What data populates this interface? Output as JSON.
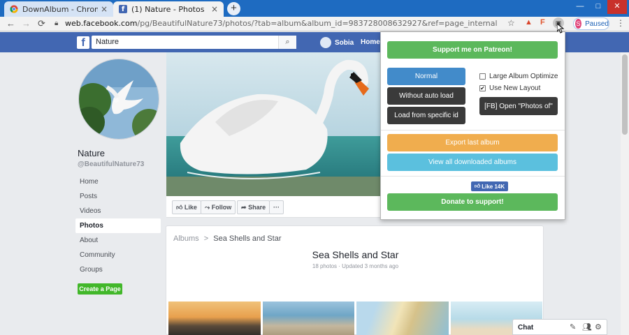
{
  "browser": {
    "tabs": [
      {
        "title": "DownAlbum - Chrome Web Store",
        "active": false
      },
      {
        "title": "(1) Nature - Photos",
        "active": true
      }
    ],
    "new_tab": "+",
    "url_host": "web.facebook.com",
    "url_path": "/pg/BeautifulNature73/photos/?tab=album&album_id=983728008632927&ref=page_internal",
    "profile_button": {
      "initial": "S",
      "label": "Paused"
    },
    "colors": {
      "chrome_frame": "#1e6bc1",
      "fb_blue": "#4267b2"
    }
  },
  "fb": {
    "search_value": "Nature",
    "user_name": "Sobia",
    "home_label": "Home",
    "page_name": "Nature",
    "page_handle": "@BeautifulNature73",
    "left_nav": [
      "Home",
      "Posts",
      "Videos",
      "Photos",
      "About",
      "Community",
      "Groups"
    ],
    "left_nav_active": "Photos",
    "create_page": "Create a Page",
    "actions": {
      "like": "Like",
      "follow": "Follow",
      "share": "Share",
      "more": "···"
    },
    "album": {
      "breadcrumb_root": "Albums",
      "breadcrumb_sep": ">",
      "breadcrumb_current": "Sea Shells and Star",
      "title": "Sea Shells and Star",
      "meta": "18 photos · Updated 3 months ago"
    },
    "chat": {
      "label": "Chat"
    }
  },
  "popup": {
    "patreon": "Support me on Patreon!",
    "normal": "Normal",
    "without_auto_load": "Without auto load",
    "load_specific": "Load from specific id",
    "large_album": "Large Album Optimize",
    "large_album_checked": false,
    "new_layout": "Use New Layout",
    "new_layout_checked": true,
    "open_photos_of": "[FB] Open \"Photos of\"",
    "export_last": "Export last album",
    "view_all": "View all downloaded albums",
    "like_label": "Like 14K",
    "donate": "Donate to support!",
    "colors": {
      "green": "#5cb85c",
      "blue": "#428bca",
      "dark": "#3a3a3a",
      "orange": "#f0ad4e",
      "cyan": "#5bc0de"
    }
  }
}
